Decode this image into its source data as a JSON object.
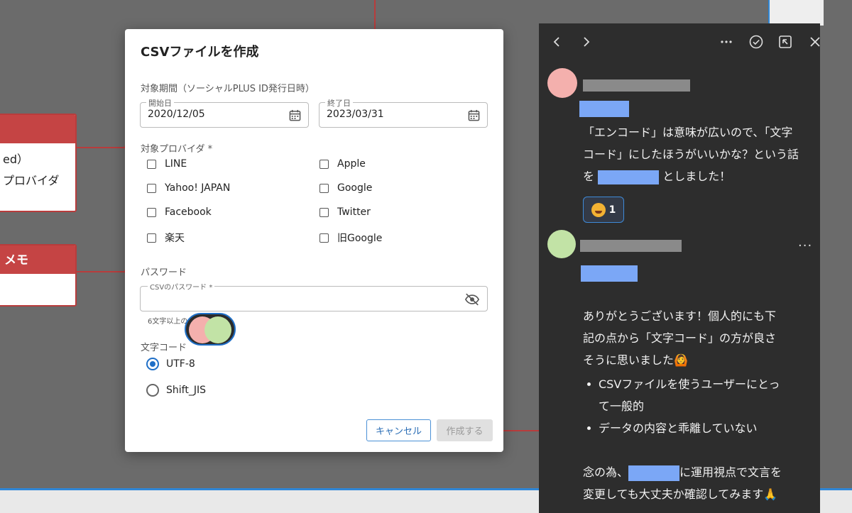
{
  "canvas": {
    "sticky_notes": [
      {
        "header": "",
        "lines": [
          "ed）",
          "プロバイダ"
        ]
      },
      {
        "header": "メモ",
        "lines": []
      }
    ]
  },
  "dialog": {
    "title": "CSVファイルを作成",
    "period": {
      "label": "対象期間（ソーシャルPLUS ID発行日時）",
      "start": {
        "label": "開始日",
        "value": "2020/12/05"
      },
      "end": {
        "label": "終了日",
        "value": "2023/03/31"
      }
    },
    "providers": {
      "label": "対象プロバイダ *",
      "options": [
        {
          "label": "LINE",
          "checked": false
        },
        {
          "label": "Apple",
          "checked": false
        },
        {
          "label": "Yahoo! JAPAN",
          "checked": false
        },
        {
          "label": "Google",
          "checked": false
        },
        {
          "label": "Facebook",
          "checked": false
        },
        {
          "label": "Twitter",
          "checked": false
        },
        {
          "label": "楽天",
          "checked": false
        },
        {
          "label": "旧Google",
          "checked": false
        }
      ]
    },
    "password": {
      "label": "パスワード",
      "field_label": "CSVのパスワード *",
      "value": "",
      "helper": "6文字以上の"
    },
    "encoding": {
      "label": "文字コード",
      "options": [
        {
          "label": "UTF-8",
          "selected": true
        },
        {
          "label": "Shift_JIS",
          "selected": false
        }
      ]
    },
    "buttons": {
      "cancel": "キャンセル",
      "create": "作成する"
    }
  },
  "comment_panel": {
    "comments": [
      {
        "avatar_color": "#f4b0ad",
        "text_parts": [
          "「エンコード」は意味が広いので、「文字",
          "コード」にしたほうがいいかな？という話",
          "を",
          "としました！"
        ],
        "reaction": {
          "emoji": "star-struck-emoji",
          "count": "1"
        }
      },
      {
        "avatar_color": "#c2e3a6",
        "text_lines": [
          "ありがとうございます！個人的にも下",
          "記の点から「文字コード」の方が良さ",
          "そうに思いました"
        ],
        "emoji_after": "🙆",
        "bullets": [
          "CSVファイルを使うユーザーにとっ",
          "て一般的",
          "データの内容と乖離していない"
        ],
        "tail": [
          "念の為、",
          "に運用視点で文言を",
          "変更しても大丈夫か確認してみます🙏"
        ]
      }
    ]
  }
}
